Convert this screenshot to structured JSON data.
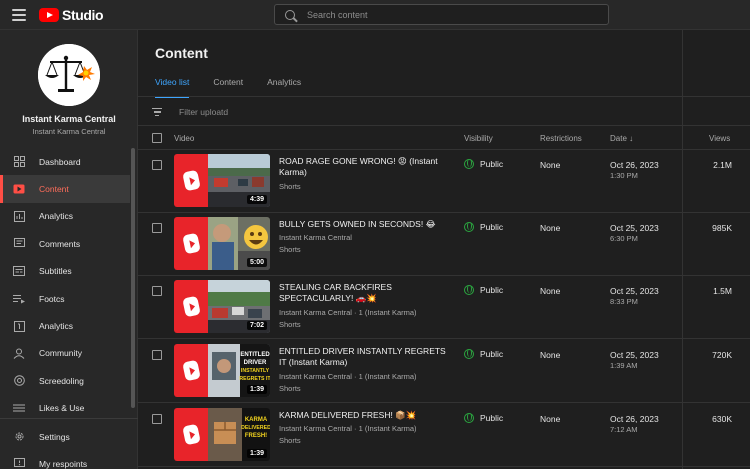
{
  "app": {
    "brand": "Studio",
    "search_placeholder": "Search content"
  },
  "channel": {
    "name": "Instant Karma Central",
    "handle": "Instant Karma Central"
  },
  "sidebar": {
    "items": [
      {
        "label": "Dashboard",
        "icon": "dashboard-icon",
        "active": false
      },
      {
        "label": "Content",
        "icon": "content-icon",
        "active": true
      },
      {
        "label": "Analytics",
        "icon": "analytics-icon",
        "active": false
      },
      {
        "label": "Comments",
        "icon": "comments-icon",
        "active": false
      },
      {
        "label": "Subtitles",
        "icon": "subtitles-icon",
        "active": false
      },
      {
        "label": "Footcs",
        "icon": "playlist-icon",
        "active": false
      },
      {
        "label": "Analytics",
        "icon": "analytics-box-icon",
        "active": false
      },
      {
        "label": "Community",
        "icon": "community-icon",
        "active": false
      },
      {
        "label": "Screedoling",
        "icon": "schedule-icon",
        "active": false
      },
      {
        "label": "Likes & Use",
        "icon": "likes-icon",
        "active": false
      }
    ],
    "settings_label": "Settings",
    "feedback_label": "My respoints"
  },
  "main": {
    "title": "Content",
    "tabs": [
      {
        "label": "Video list",
        "active": true
      },
      {
        "label": "Content",
        "active": false
      },
      {
        "label": "Analytics",
        "active": false
      }
    ],
    "filter_placeholder": "Filter uploatd"
  },
  "table": {
    "headers": {
      "video": "Video",
      "visibility": "Visibility",
      "restrictions": "Restrictions",
      "date": "Date ↓",
      "views": "Views"
    },
    "rows": [
      {
        "title": "ROAD RAGE GONE WRONG! 😡 (Instant Karma)",
        "sub1": "",
        "sub2": "Shorts",
        "duration": "4:39",
        "visibility": "Public",
        "restrictions": "None",
        "date": "Oct 26, 2023",
        "time": "1:30 PM",
        "views": "2.1M"
      },
      {
        "title": "BULLY GETS OWNED IN SECONDS! 😂",
        "sub1": "Instant Karma Central",
        "sub2": "Shorts",
        "duration": "5:00",
        "visibility": "Public",
        "restrictions": "None",
        "date": "Oct 25, 2023",
        "time": "6:30 PM",
        "views": "985K"
      },
      {
        "title": "STEALING CAR BACKFIRES SPECTACULARLY! 🚗💥",
        "sub1": "Instant Karma Central · 1 (Instant Karma)",
        "sub2": "Shorts",
        "duration": "7:02",
        "visibility": "Public",
        "restrictions": "None",
        "date": "Oct 25, 2023",
        "time": "8:33 PM",
        "views": "1.5M"
      },
      {
        "title": "ENTITLED DRIVER INSTANTLY REGRETS IT (Instant Karma)",
        "sub1": "Instant Karma Central · 1 (Instant Karma)",
        "sub2": "Shorts",
        "duration": "1:39",
        "overlay": "ENTITLED DRIVER INSTANTLY REGRETS IT",
        "visibility": "Public",
        "restrictions": "None",
        "date": "Oct 25, 2023",
        "time": "1:39 AM",
        "views": "720K"
      },
      {
        "title": "KARMA DELIVERED FRESH! 📦💥",
        "sub1": "Instant Karma Central · 1 (Instant Karma)",
        "sub2": "Shorts",
        "duration": "1:39",
        "overlay": "KARMA DELIVERED FRESH!",
        "visibility": "Public",
        "restrictions": "None",
        "date": "Oct 26, 2023",
        "time": "7:12 AM",
        "views": "630K"
      }
    ]
  },
  "colors": {
    "accent_red": "#ff0000",
    "active_red": "#ff4e45",
    "tab_blue": "#3ea6ff",
    "public_green": "#2ba640"
  }
}
